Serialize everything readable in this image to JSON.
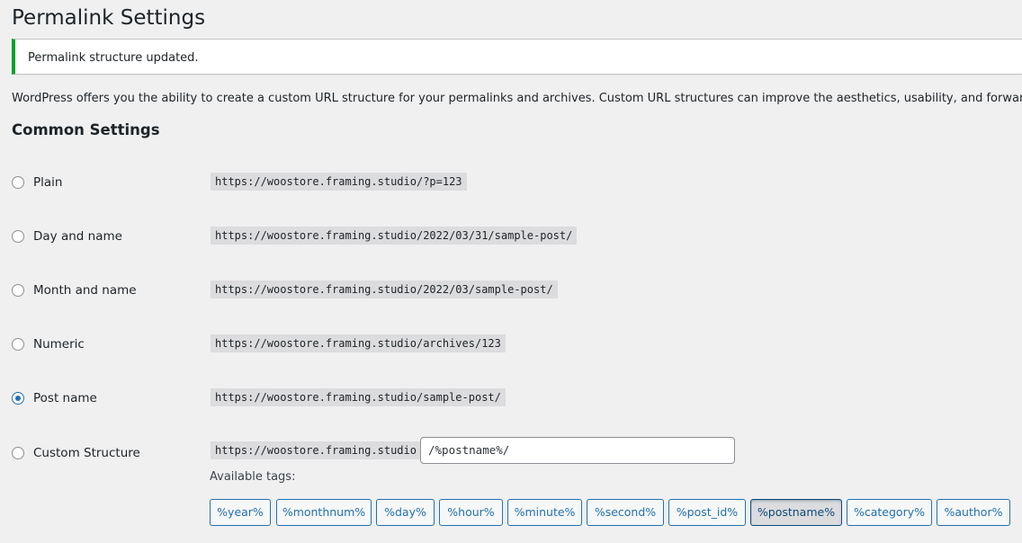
{
  "page": {
    "title": "Permalink Settings",
    "notice": "Permalink structure updated.",
    "intro": "WordPress offers you the ability to create a custom URL structure for your permalinks and archives. Custom URL structures can improve the aesthetics, usability, and forward-compatibility of your links.",
    "section_title": "Common Settings"
  },
  "options": [
    {
      "label": "Plain",
      "example": "https://woostore.framing.studio/?p=123",
      "checked": false
    },
    {
      "label": "Day and name",
      "example": "https://woostore.framing.studio/2022/03/31/sample-post/",
      "checked": false
    },
    {
      "label": "Month and name",
      "example": "https://woostore.framing.studio/2022/03/sample-post/",
      "checked": false
    },
    {
      "label": "Numeric",
      "example": "https://woostore.framing.studio/archives/123",
      "checked": false
    },
    {
      "label": "Post name",
      "example": "https://woostore.framing.studio/sample-post/",
      "checked": true
    },
    {
      "label": "Custom Structure",
      "example": "https://woostore.framing.studio",
      "checked": false
    }
  ],
  "custom": {
    "value": "/%postname%/",
    "tags_label": "Available tags:"
  },
  "tags": [
    {
      "label": "%year%",
      "active": false
    },
    {
      "label": "%monthnum%",
      "active": false
    },
    {
      "label": "%day%",
      "active": false
    },
    {
      "label": "%hour%",
      "active": false
    },
    {
      "label": "%minute%",
      "active": false
    },
    {
      "label": "%second%",
      "active": false
    },
    {
      "label": "%post_id%",
      "active": false
    },
    {
      "label": "%postname%",
      "active": true
    },
    {
      "label": "%category%",
      "active": false
    },
    {
      "label": "%author%",
      "active": false
    }
  ],
  "colors": {
    "accent": "#2271b1",
    "success": "#00a32a",
    "background": "#f0f0f1"
  }
}
